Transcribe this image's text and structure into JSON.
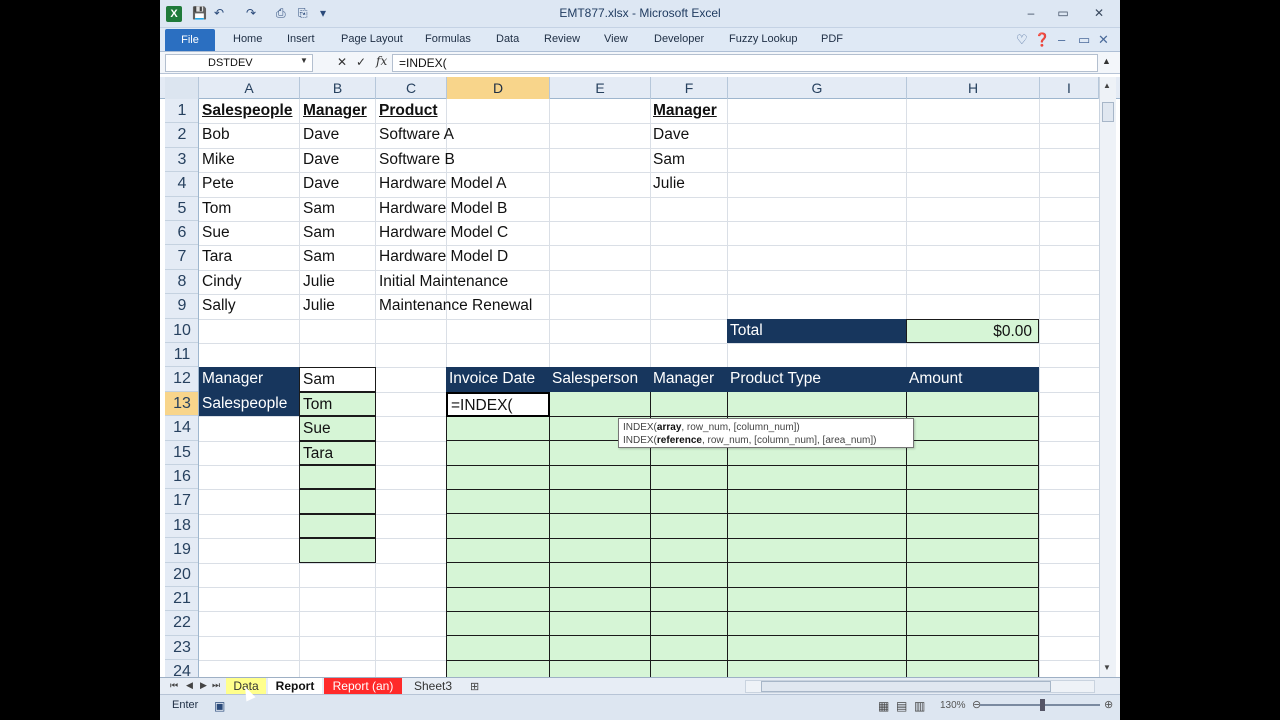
{
  "window": {
    "title": "EMT877.xlsx - Microsoft Excel",
    "minimize": "–",
    "restore": "▭",
    "close": "✕"
  },
  "ribbon": {
    "file": "File",
    "tabs": [
      "Home",
      "Insert",
      "Page Layout",
      "Formulas",
      "Data",
      "Review",
      "View",
      "Developer",
      "Fuzzy Lookup",
      "PDF"
    ]
  },
  "formula_bar": {
    "name_box": "DSTDEV",
    "cancel": "✕",
    "enter": "✓",
    "fx": "fx",
    "formula": "=INDEX("
  },
  "columns": [
    "A",
    "B",
    "C",
    "D",
    "E",
    "F",
    "G",
    "H",
    "I"
  ],
  "rows": [
    "1",
    "2",
    "3",
    "4",
    "5",
    "6",
    "7",
    "8",
    "9",
    "10",
    "11",
    "12",
    "13",
    "14",
    "15",
    "16",
    "17",
    "18",
    "19",
    "20",
    "21",
    "22",
    "23",
    "24"
  ],
  "data_table": {
    "headers": [
      "Salespeople",
      "Manager",
      "Product",
      "Manager"
    ],
    "salespeople": [
      "Bob",
      "Mike",
      "Pete",
      "Tom",
      "Sue",
      "Tara",
      "Cindy",
      "Sally"
    ],
    "managers": [
      "Dave",
      "Dave",
      "Dave",
      "Sam",
      "Sam",
      "Sam",
      "Julie",
      "Julie"
    ],
    "products": [
      "Software A",
      "Software B",
      "Hardware Model A",
      "Hardware Model B",
      "Hardware Model C",
      "Hardware Model D",
      "Initial Maintenance",
      "Maintenance Renewal"
    ],
    "manager_list": [
      "Dave",
      "Sam",
      "Julie"
    ]
  },
  "total": {
    "label": "Total",
    "value": "$0.00"
  },
  "criteria": {
    "manager_label": "Manager",
    "manager_value": "Sam",
    "salespeople_label": "Salespeople",
    "salespeople_values": [
      "Tom",
      "Sue",
      "Tara"
    ]
  },
  "report": {
    "headers": [
      "Invoice Date",
      "Salesperson",
      "Manager",
      "Product Type",
      "Amount"
    ],
    "editing_cell": "=INDEX("
  },
  "tooltip": {
    "line1_fn": "INDEX(",
    "line1_arg": "array",
    "line1_rest": ", row_num, [column_num])",
    "line2_fn": "INDEX(",
    "line2_arg": "reference",
    "line2_rest": ", row_num, [column_num], [area_num])"
  },
  "sheet_tabs": [
    "Data",
    "Report",
    "Report (an)",
    "Sheet3"
  ],
  "status": {
    "mode": "Enter",
    "zoom": "130%"
  }
}
